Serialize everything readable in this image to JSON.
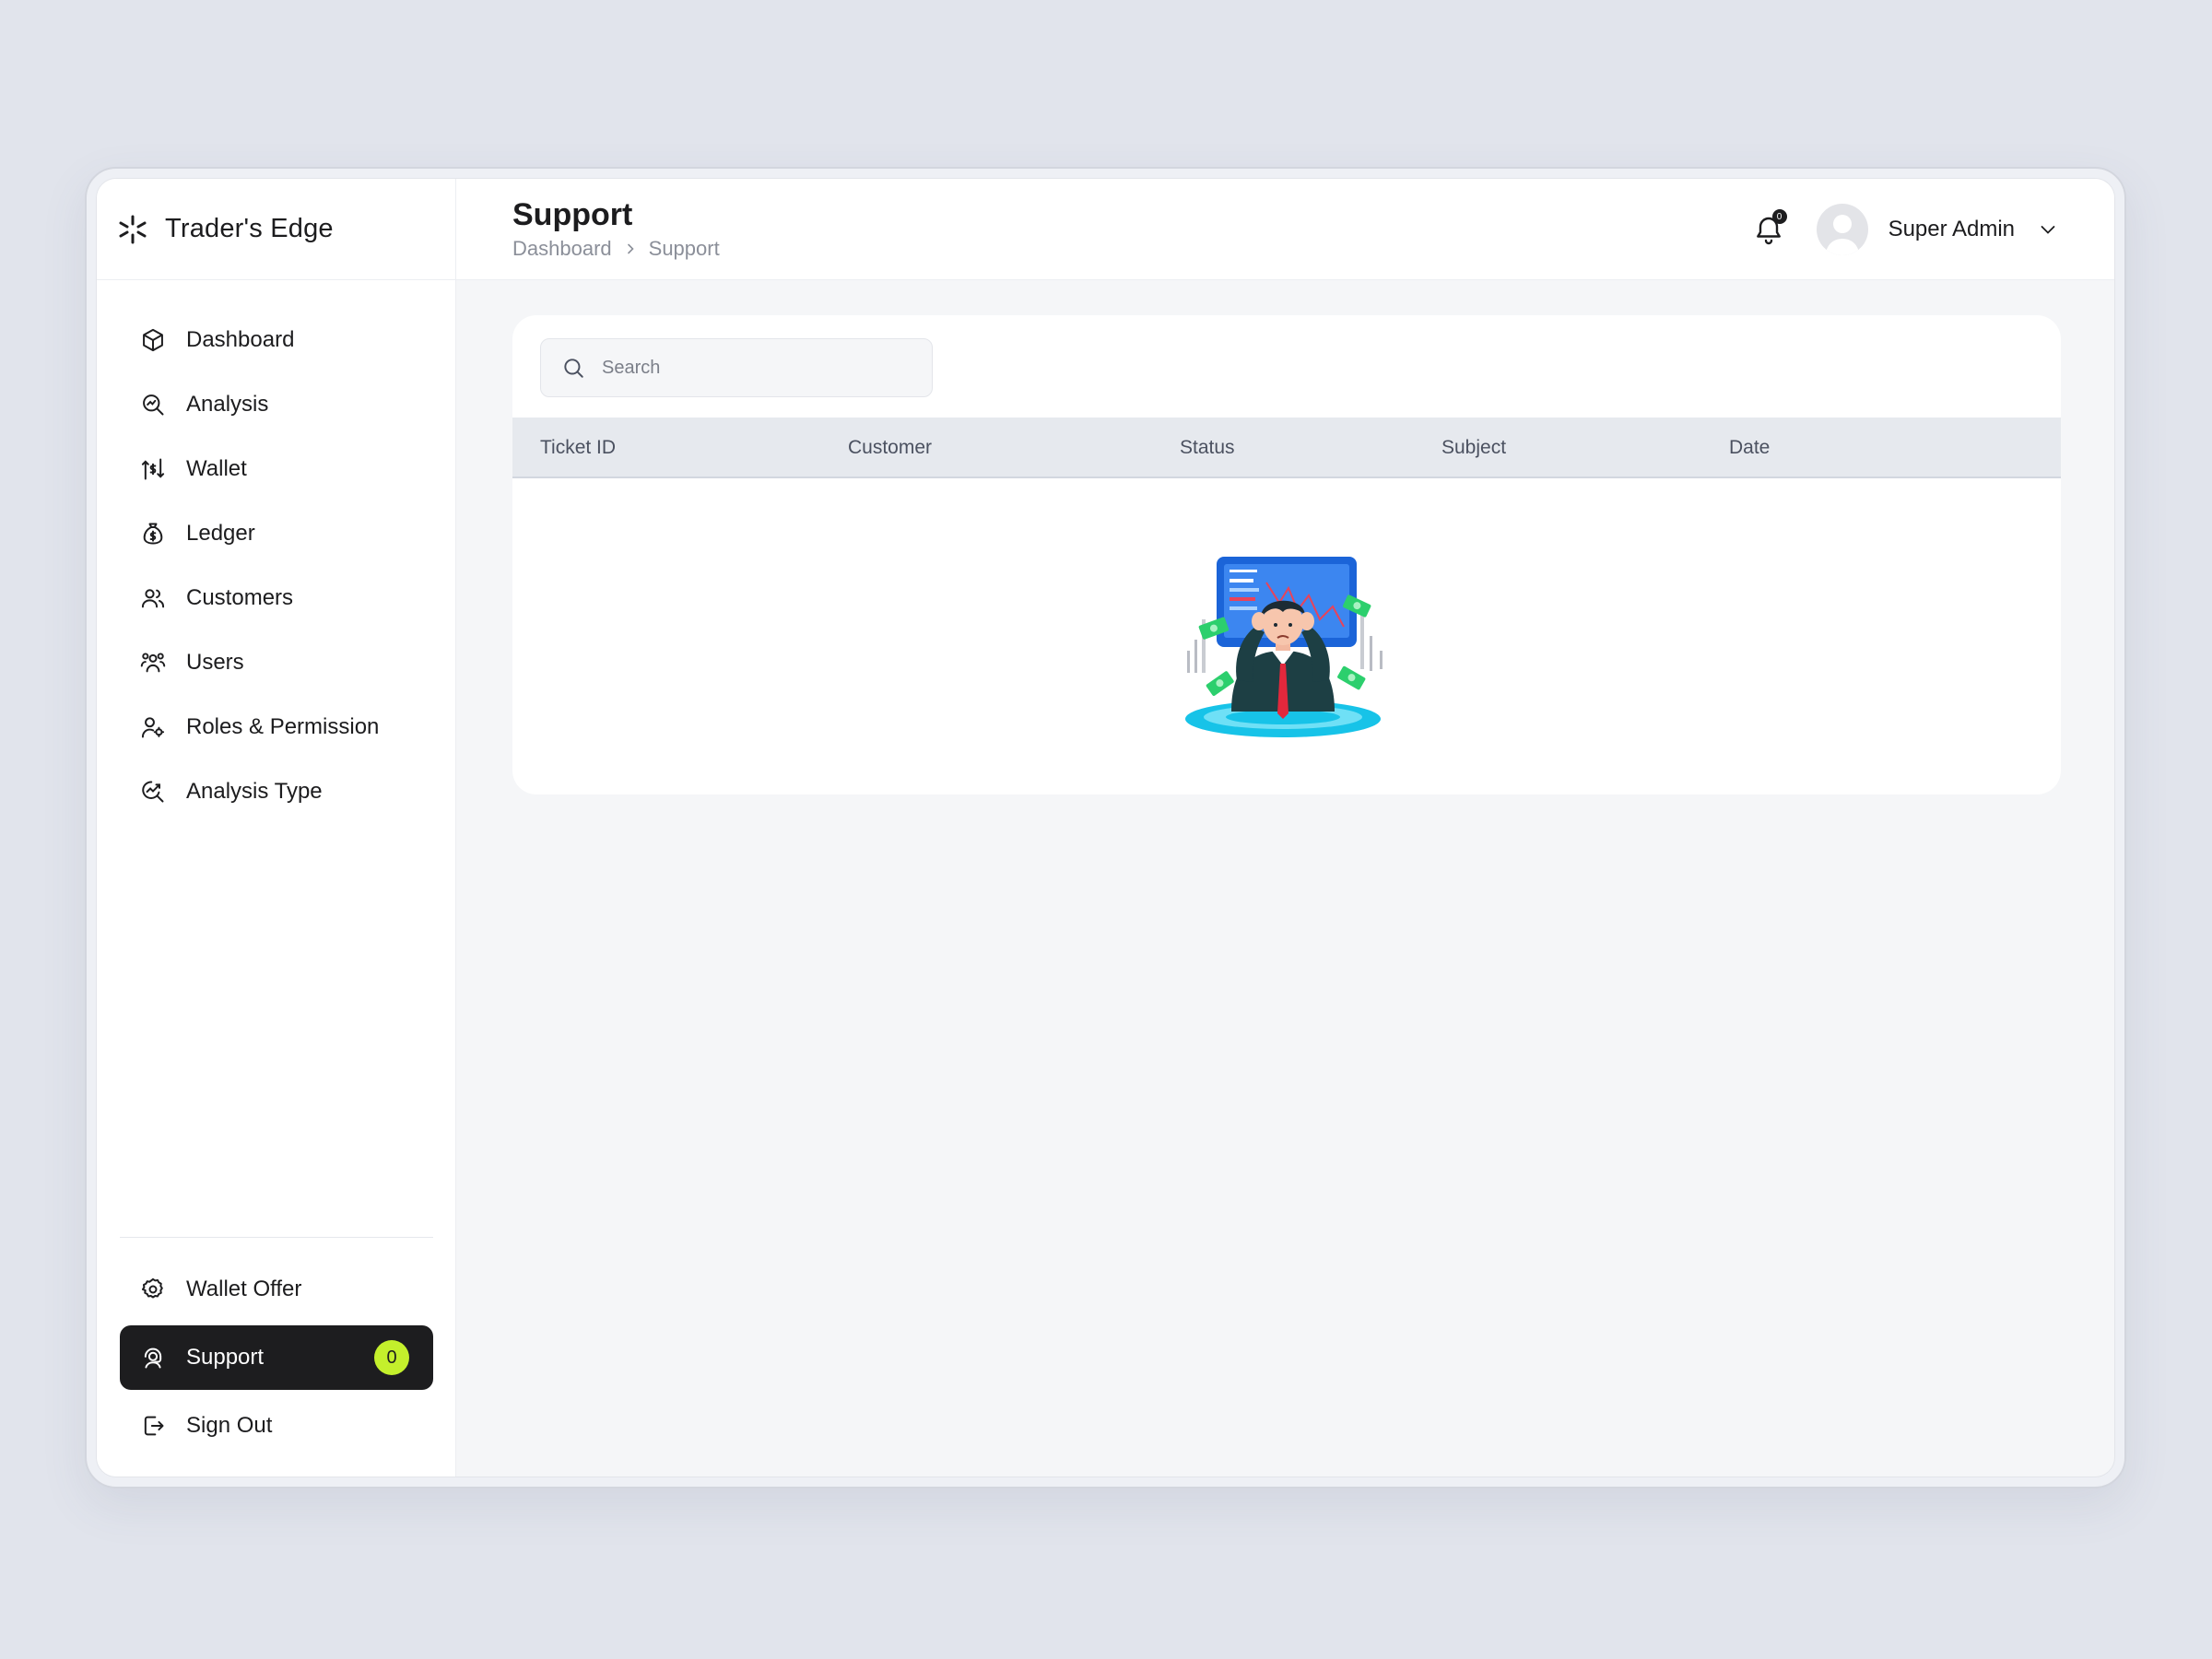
{
  "brand": {
    "name": "Trader's Edge"
  },
  "sidebar": {
    "items": [
      {
        "label": "Dashboard",
        "icon": "cube-icon"
      },
      {
        "label": "Analysis",
        "icon": "analysis-search-icon"
      },
      {
        "label": "Wallet",
        "icon": "wallet-transfer-icon"
      },
      {
        "label": "Ledger",
        "icon": "money-bag-icon"
      },
      {
        "label": "Customers",
        "icon": "customers-icon"
      },
      {
        "label": "Users",
        "icon": "users-group-icon"
      },
      {
        "label": "Roles & Permission",
        "icon": "user-key-icon"
      },
      {
        "label": "Analysis Type",
        "icon": "search-chart-icon"
      }
    ],
    "bottom_items": [
      {
        "label": "Wallet Offer",
        "icon": "gear-icon"
      },
      {
        "label": "Support",
        "icon": "support-agent-icon",
        "badge": "0",
        "active": true
      },
      {
        "label": "Sign Out",
        "icon": "sign-out-icon"
      }
    ]
  },
  "header": {
    "title": "Support",
    "breadcrumb": [
      "Dashboard",
      "Support"
    ],
    "notification_count": "0",
    "user_name": "Super Admin"
  },
  "search": {
    "placeholder": "Search",
    "value": ""
  },
  "table": {
    "columns": [
      "Ticket ID",
      "Customer",
      "Status",
      "Subject",
      "Date"
    ],
    "rows": []
  },
  "colors": {
    "accent": "#c4f02c",
    "active_bg": "#1d1d1f",
    "table_header_bg": "#e6e9ee"
  }
}
